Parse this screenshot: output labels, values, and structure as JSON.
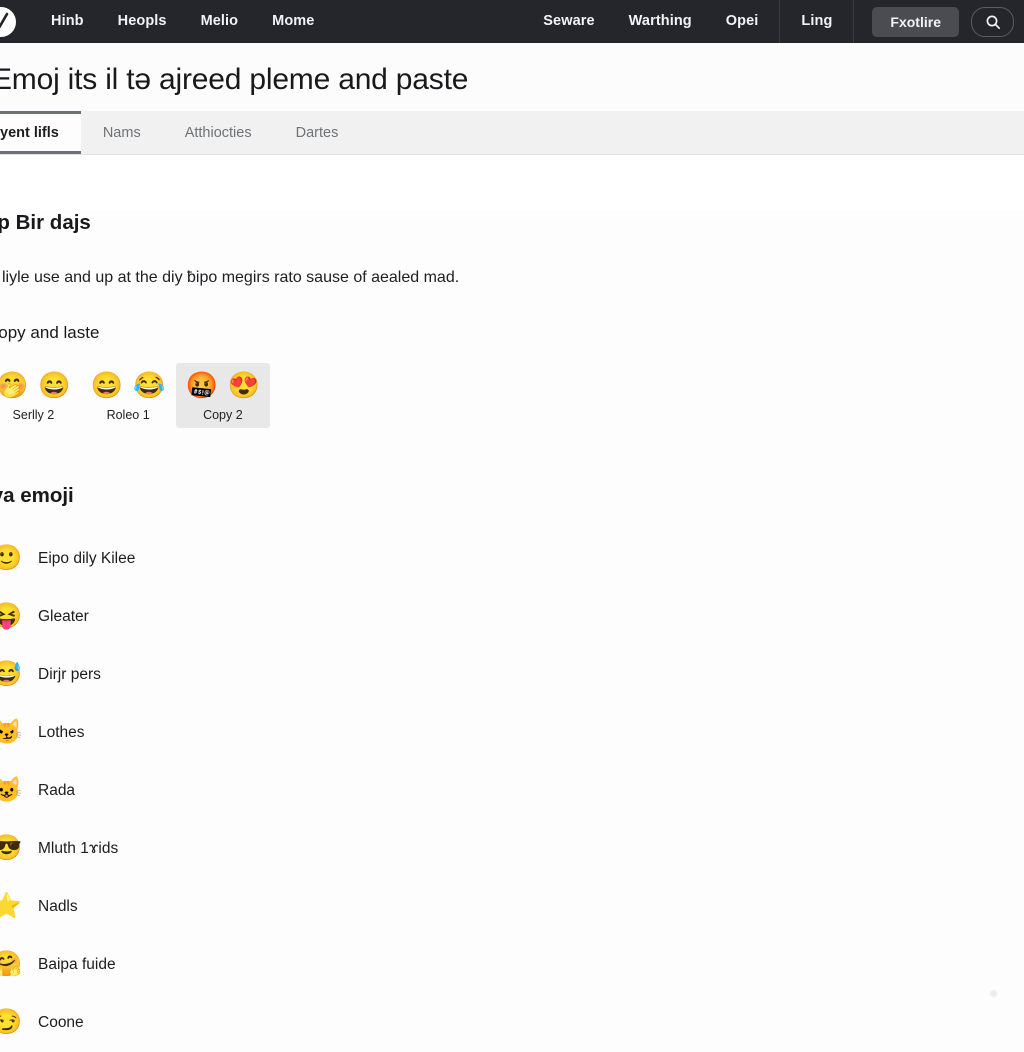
{
  "navbar": {
    "logo_icon": "check-badge-icon",
    "left_items": [
      {
        "label": "Hinb"
      },
      {
        "label": "Heopls"
      },
      {
        "label": "Melio"
      },
      {
        "label": "Mome"
      }
    ],
    "right_items": [
      {
        "label": "Seware"
      },
      {
        "label": "Warthing"
      },
      {
        "label": "Opei"
      }
    ],
    "ling_label": "Ling",
    "action_button": "Fxotlire",
    "search_icon": "search-icon",
    "background": "#25262b",
    "button_background": "#4a4c52"
  },
  "header": {
    "title": "Emoj its il tǝ ajreed pleme and paste"
  },
  "tabs": [
    {
      "label": "yent lifls",
      "active": true
    },
    {
      "label": "Nams",
      "active": false
    },
    {
      "label": "Atthiocties",
      "active": false
    },
    {
      "label": "Dartes",
      "active": false
    }
  ],
  "main": {
    "section_heading": "ep Bir dajs",
    "body_text": "ly liyle use and up at the diy ƀipo megirs rato sause of aealed mad.",
    "copy_heading": "Copy and laste",
    "copy_chips": [
      {
        "label": "Serlly 2",
        "emojis": [
          "🤭",
          "😄"
        ],
        "highlight": false
      },
      {
        "label": "Roleo 1",
        "emojis": [
          "😄",
          "😂"
        ],
        "highlight": false
      },
      {
        "label": "Copy 2",
        "emojis": [
          "🤬",
          "😍"
        ],
        "highlight": true
      }
    ],
    "list_heading": "lya emoji",
    "emoji_items": [
      {
        "glyph": "🙂",
        "name": "Eipo dily Kilee"
      },
      {
        "glyph": "😝",
        "name": "Gleater"
      },
      {
        "glyph": "😅",
        "name": "Dirjr pers"
      },
      {
        "glyph": "😼",
        "name": "Lothes"
      },
      {
        "glyph": "😺",
        "name": "Rada"
      },
      {
        "glyph": "😎",
        "name": "Mluth 1ɤids"
      },
      {
        "glyph": "⭐",
        "name": "Nadls"
      },
      {
        "glyph": "🤗",
        "name": "Baipa fuide"
      },
      {
        "glyph": "😏",
        "name": "Coone"
      }
    ]
  }
}
